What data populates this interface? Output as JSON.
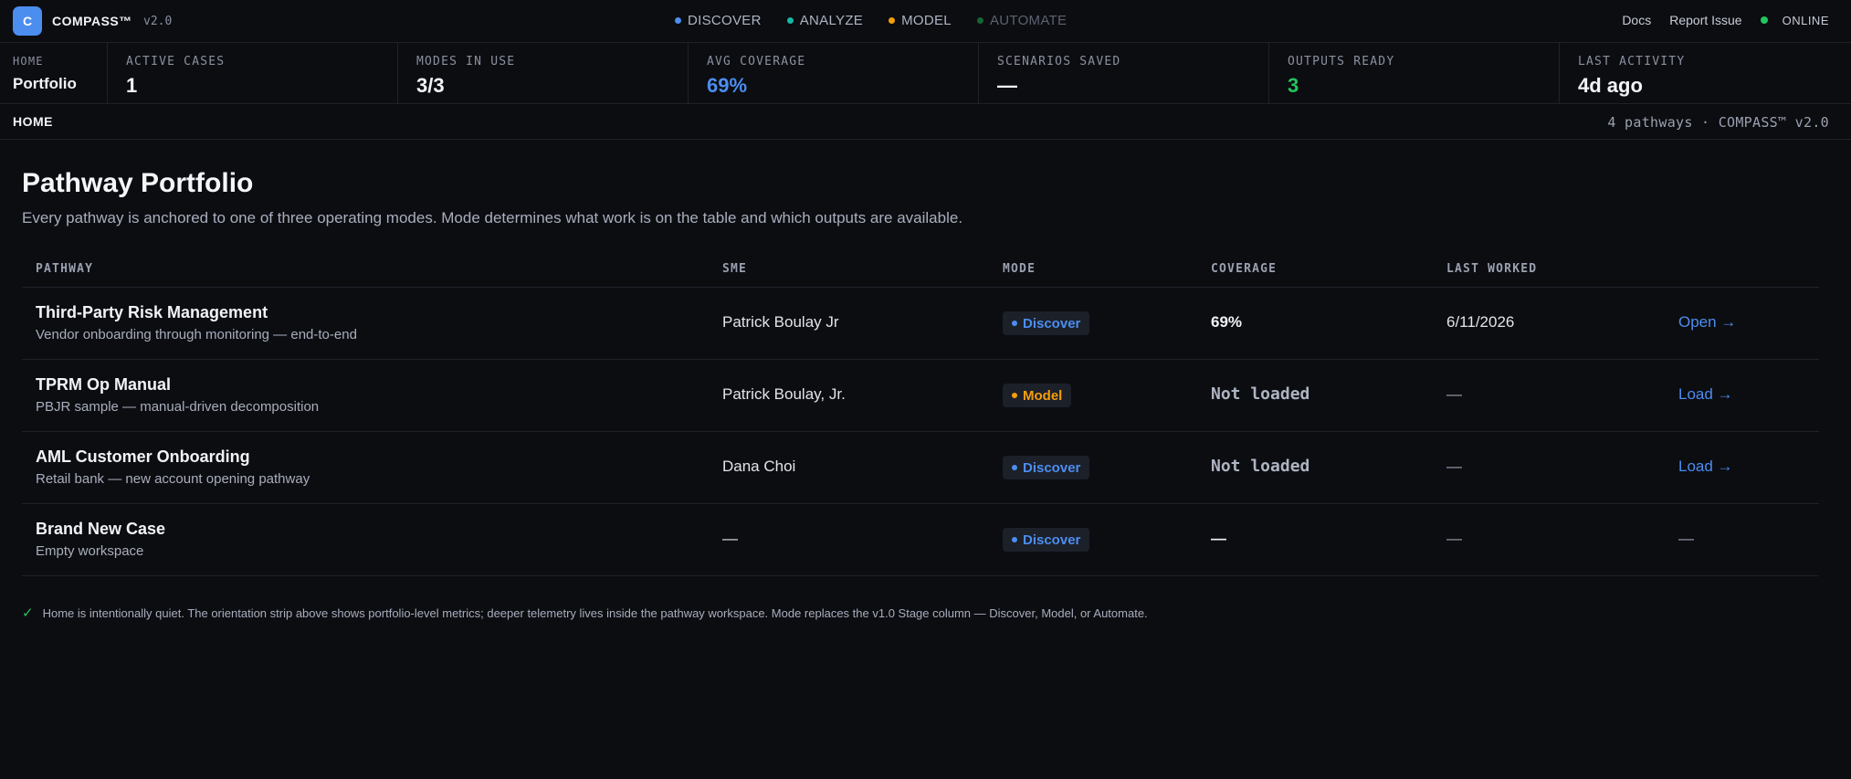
{
  "header": {
    "logo_letter": "C",
    "brand": "COMPASS™",
    "version": "v2.0",
    "modes": [
      {
        "label": "DISCOVER",
        "color": "#4c8df0",
        "dim": false
      },
      {
        "label": "ANALYZE",
        "color": "#14b8a6",
        "dim": false
      },
      {
        "label": "MODEL",
        "color": "#f59e0b",
        "dim": false
      },
      {
        "label": "AUTOMATE",
        "color": "#166534",
        "dim": true
      }
    ],
    "links": {
      "docs": "Docs",
      "report": "Report Issue"
    },
    "status": "ONLINE"
  },
  "strip": {
    "home_label": "HOME",
    "home_value": "Portfolio",
    "metrics": [
      {
        "label": "ACTIVE CASES",
        "value": "1",
        "color": "#f2f3f6"
      },
      {
        "label": "MODES IN USE",
        "value": "3/3",
        "color": "#f2f3f6"
      },
      {
        "label": "AVG COVERAGE",
        "value": "69%",
        "color": "#4c8df0"
      },
      {
        "label": "SCENARIOS SAVED",
        "value": "—",
        "color": "#f2f3f6"
      },
      {
        "label": "OUTPUTS READY",
        "value": "3",
        "color": "#22c55e"
      },
      {
        "label": "LAST ACTIVITY",
        "value": "4d ago",
        "color": "#f2f3f6"
      }
    ]
  },
  "breadcrumb": {
    "label": "HOME",
    "info": "4 pathways · COMPASS™ v2.0"
  },
  "main": {
    "title": "Pathway Portfolio",
    "subtitle": "Every pathway is anchored to one of three operating modes. Mode determines what work is on the table and which outputs are available."
  },
  "table": {
    "headers": {
      "pathway": "PATHWAY",
      "sme": "SME",
      "mode": "MODE",
      "coverage": "COVERAGE",
      "last": "LAST WORKED"
    },
    "rows": [
      {
        "name": "Third-Party Risk Management",
        "desc": "Vendor onboarding through monitoring — end-to-end",
        "sme": "Patrick Boulay Jr",
        "mode": "Discover",
        "mode_color": "#4c8df0",
        "coverage": "69%",
        "coverage_style": "value",
        "last": "6/11/2026",
        "action": "Open →"
      },
      {
        "name": "TPRM Op Manual",
        "desc": "PBJR sample — manual-driven decomposition",
        "sme": "Patrick Boulay, Jr.",
        "mode": "Model",
        "mode_color": "#f59e0b",
        "coverage": "Not loaded",
        "coverage_style": "notloaded",
        "last": "—",
        "action": "Load →"
      },
      {
        "name": "AML Customer Onboarding",
        "desc": "Retail bank — new account opening pathway",
        "sme": "Dana Choi",
        "mode": "Discover",
        "mode_color": "#4c8df0",
        "coverage": "Not loaded",
        "coverage_style": "notloaded",
        "last": "—",
        "action": "Load →"
      },
      {
        "name": "Brand New Case",
        "desc": "Empty workspace",
        "sme": "—",
        "mode": "Discover",
        "mode_color": "#4c8df0",
        "coverage": "—",
        "coverage_style": "value",
        "last": "—",
        "action": "—"
      }
    ]
  },
  "footnote": "Home is intentionally quiet. The orientation strip above shows portfolio-level metrics; deeper telemetry lives inside the pathway workspace. Mode replaces the v1.0 Stage column — Discover, Model, or Automate."
}
